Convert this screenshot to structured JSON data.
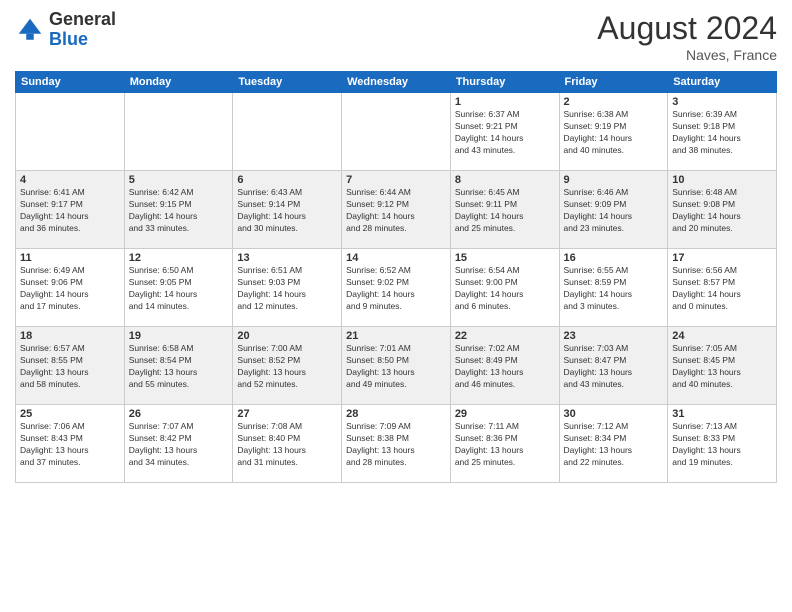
{
  "logo": {
    "general": "General",
    "blue": "Blue"
  },
  "header": {
    "month_year": "August 2024",
    "location": "Naves, France"
  },
  "days_of_week": [
    "Sunday",
    "Monday",
    "Tuesday",
    "Wednesday",
    "Thursday",
    "Friday",
    "Saturday"
  ],
  "weeks": [
    [
      {
        "day": "",
        "info": ""
      },
      {
        "day": "",
        "info": ""
      },
      {
        "day": "",
        "info": ""
      },
      {
        "day": "",
        "info": ""
      },
      {
        "day": "1",
        "info": "Sunrise: 6:37 AM\nSunset: 9:21 PM\nDaylight: 14 hours\nand 43 minutes."
      },
      {
        "day": "2",
        "info": "Sunrise: 6:38 AM\nSunset: 9:19 PM\nDaylight: 14 hours\nand 40 minutes."
      },
      {
        "day": "3",
        "info": "Sunrise: 6:39 AM\nSunset: 9:18 PM\nDaylight: 14 hours\nand 38 minutes."
      }
    ],
    [
      {
        "day": "4",
        "info": "Sunrise: 6:41 AM\nSunset: 9:17 PM\nDaylight: 14 hours\nand 36 minutes."
      },
      {
        "day": "5",
        "info": "Sunrise: 6:42 AM\nSunset: 9:15 PM\nDaylight: 14 hours\nand 33 minutes."
      },
      {
        "day": "6",
        "info": "Sunrise: 6:43 AM\nSunset: 9:14 PM\nDaylight: 14 hours\nand 30 minutes."
      },
      {
        "day": "7",
        "info": "Sunrise: 6:44 AM\nSunset: 9:12 PM\nDaylight: 14 hours\nand 28 minutes."
      },
      {
        "day": "8",
        "info": "Sunrise: 6:45 AM\nSunset: 9:11 PM\nDaylight: 14 hours\nand 25 minutes."
      },
      {
        "day": "9",
        "info": "Sunrise: 6:46 AM\nSunset: 9:09 PM\nDaylight: 14 hours\nand 23 minutes."
      },
      {
        "day": "10",
        "info": "Sunrise: 6:48 AM\nSunset: 9:08 PM\nDaylight: 14 hours\nand 20 minutes."
      }
    ],
    [
      {
        "day": "11",
        "info": "Sunrise: 6:49 AM\nSunset: 9:06 PM\nDaylight: 14 hours\nand 17 minutes."
      },
      {
        "day": "12",
        "info": "Sunrise: 6:50 AM\nSunset: 9:05 PM\nDaylight: 14 hours\nand 14 minutes."
      },
      {
        "day": "13",
        "info": "Sunrise: 6:51 AM\nSunset: 9:03 PM\nDaylight: 14 hours\nand 12 minutes."
      },
      {
        "day": "14",
        "info": "Sunrise: 6:52 AM\nSunset: 9:02 PM\nDaylight: 14 hours\nand 9 minutes."
      },
      {
        "day": "15",
        "info": "Sunrise: 6:54 AM\nSunset: 9:00 PM\nDaylight: 14 hours\nand 6 minutes."
      },
      {
        "day": "16",
        "info": "Sunrise: 6:55 AM\nSunset: 8:59 PM\nDaylight: 14 hours\nand 3 minutes."
      },
      {
        "day": "17",
        "info": "Sunrise: 6:56 AM\nSunset: 8:57 PM\nDaylight: 14 hours\nand 0 minutes."
      }
    ],
    [
      {
        "day": "18",
        "info": "Sunrise: 6:57 AM\nSunset: 8:55 PM\nDaylight: 13 hours\nand 58 minutes."
      },
      {
        "day": "19",
        "info": "Sunrise: 6:58 AM\nSunset: 8:54 PM\nDaylight: 13 hours\nand 55 minutes."
      },
      {
        "day": "20",
        "info": "Sunrise: 7:00 AM\nSunset: 8:52 PM\nDaylight: 13 hours\nand 52 minutes."
      },
      {
        "day": "21",
        "info": "Sunrise: 7:01 AM\nSunset: 8:50 PM\nDaylight: 13 hours\nand 49 minutes."
      },
      {
        "day": "22",
        "info": "Sunrise: 7:02 AM\nSunset: 8:49 PM\nDaylight: 13 hours\nand 46 minutes."
      },
      {
        "day": "23",
        "info": "Sunrise: 7:03 AM\nSunset: 8:47 PM\nDaylight: 13 hours\nand 43 minutes."
      },
      {
        "day": "24",
        "info": "Sunrise: 7:05 AM\nSunset: 8:45 PM\nDaylight: 13 hours\nand 40 minutes."
      }
    ],
    [
      {
        "day": "25",
        "info": "Sunrise: 7:06 AM\nSunset: 8:43 PM\nDaylight: 13 hours\nand 37 minutes."
      },
      {
        "day": "26",
        "info": "Sunrise: 7:07 AM\nSunset: 8:42 PM\nDaylight: 13 hours\nand 34 minutes."
      },
      {
        "day": "27",
        "info": "Sunrise: 7:08 AM\nSunset: 8:40 PM\nDaylight: 13 hours\nand 31 minutes."
      },
      {
        "day": "28",
        "info": "Sunrise: 7:09 AM\nSunset: 8:38 PM\nDaylight: 13 hours\nand 28 minutes."
      },
      {
        "day": "29",
        "info": "Sunrise: 7:11 AM\nSunset: 8:36 PM\nDaylight: 13 hours\nand 25 minutes."
      },
      {
        "day": "30",
        "info": "Sunrise: 7:12 AM\nSunset: 8:34 PM\nDaylight: 13 hours\nand 22 minutes."
      },
      {
        "day": "31",
        "info": "Sunrise: 7:13 AM\nSunset: 8:33 PM\nDaylight: 13 hours\nand 19 minutes."
      }
    ]
  ]
}
